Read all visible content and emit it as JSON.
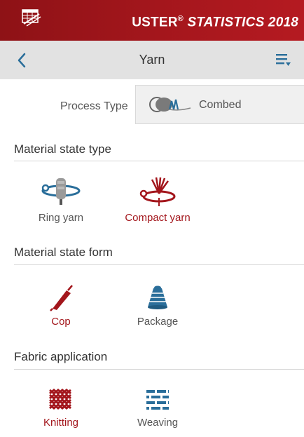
{
  "header": {
    "brand_main": "USTER",
    "brand_reg": "®",
    "brand_stat": "STATISTICS 2018"
  },
  "nav": {
    "title": "Yarn"
  },
  "process": {
    "label": "Process Type",
    "value": "Combed"
  },
  "sections": {
    "material_state_type": {
      "title": "Material state type",
      "options": [
        {
          "label": "Ring yarn",
          "selected": false,
          "icon": "ring-yarn-icon"
        },
        {
          "label": "Compact yarn",
          "selected": true,
          "icon": "compact-yarn-icon"
        }
      ]
    },
    "material_state_form": {
      "title": "Material state form",
      "options": [
        {
          "label": "Cop",
          "selected": true,
          "icon": "cop-icon"
        },
        {
          "label": "Package",
          "selected": false,
          "icon": "package-icon"
        }
      ]
    },
    "fabric_application": {
      "title": "Fabric application",
      "options": [
        {
          "label": "Knitting",
          "selected": true,
          "icon": "knitting-icon"
        },
        {
          "label": "Weaving",
          "selected": false,
          "icon": "weaving-icon"
        }
      ]
    }
  },
  "colors": {
    "brand_red": "#a3161c",
    "accent_blue": "#2a6e9a",
    "nav_gray": "#e2e2e2"
  }
}
